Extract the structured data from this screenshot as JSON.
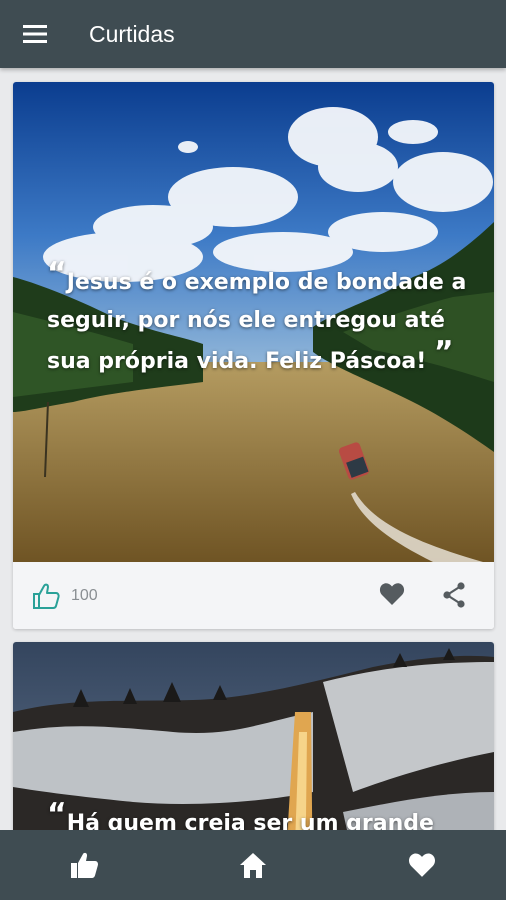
{
  "app_bar": {
    "title": "Curtidas"
  },
  "cards": [
    {
      "quote_lines": [
        "Jesus é o exemplo de bondade a",
        "seguir, por nós ele entregou até",
        "sua própria vida. Feliz Páscoa!"
      ],
      "open_mark": "“",
      "close_mark": "”",
      "likes": "100"
    },
    {
      "quote_lines": [
        "Há quem creia ser um grande"
      ],
      "open_mark": "“"
    }
  ],
  "icons": {
    "menu": "menu-icon",
    "like": "thumbs-up-icon",
    "favorite": "heart-icon",
    "share": "share-icon",
    "nav": [
      "thumbs-up-icon",
      "home-icon",
      "heart-icon"
    ]
  },
  "colors": {
    "app_bar": "#3f4c52",
    "like_accent": "#2aa198",
    "icon_gray": "#555b5f",
    "card_footer": "#f4f5f7"
  }
}
